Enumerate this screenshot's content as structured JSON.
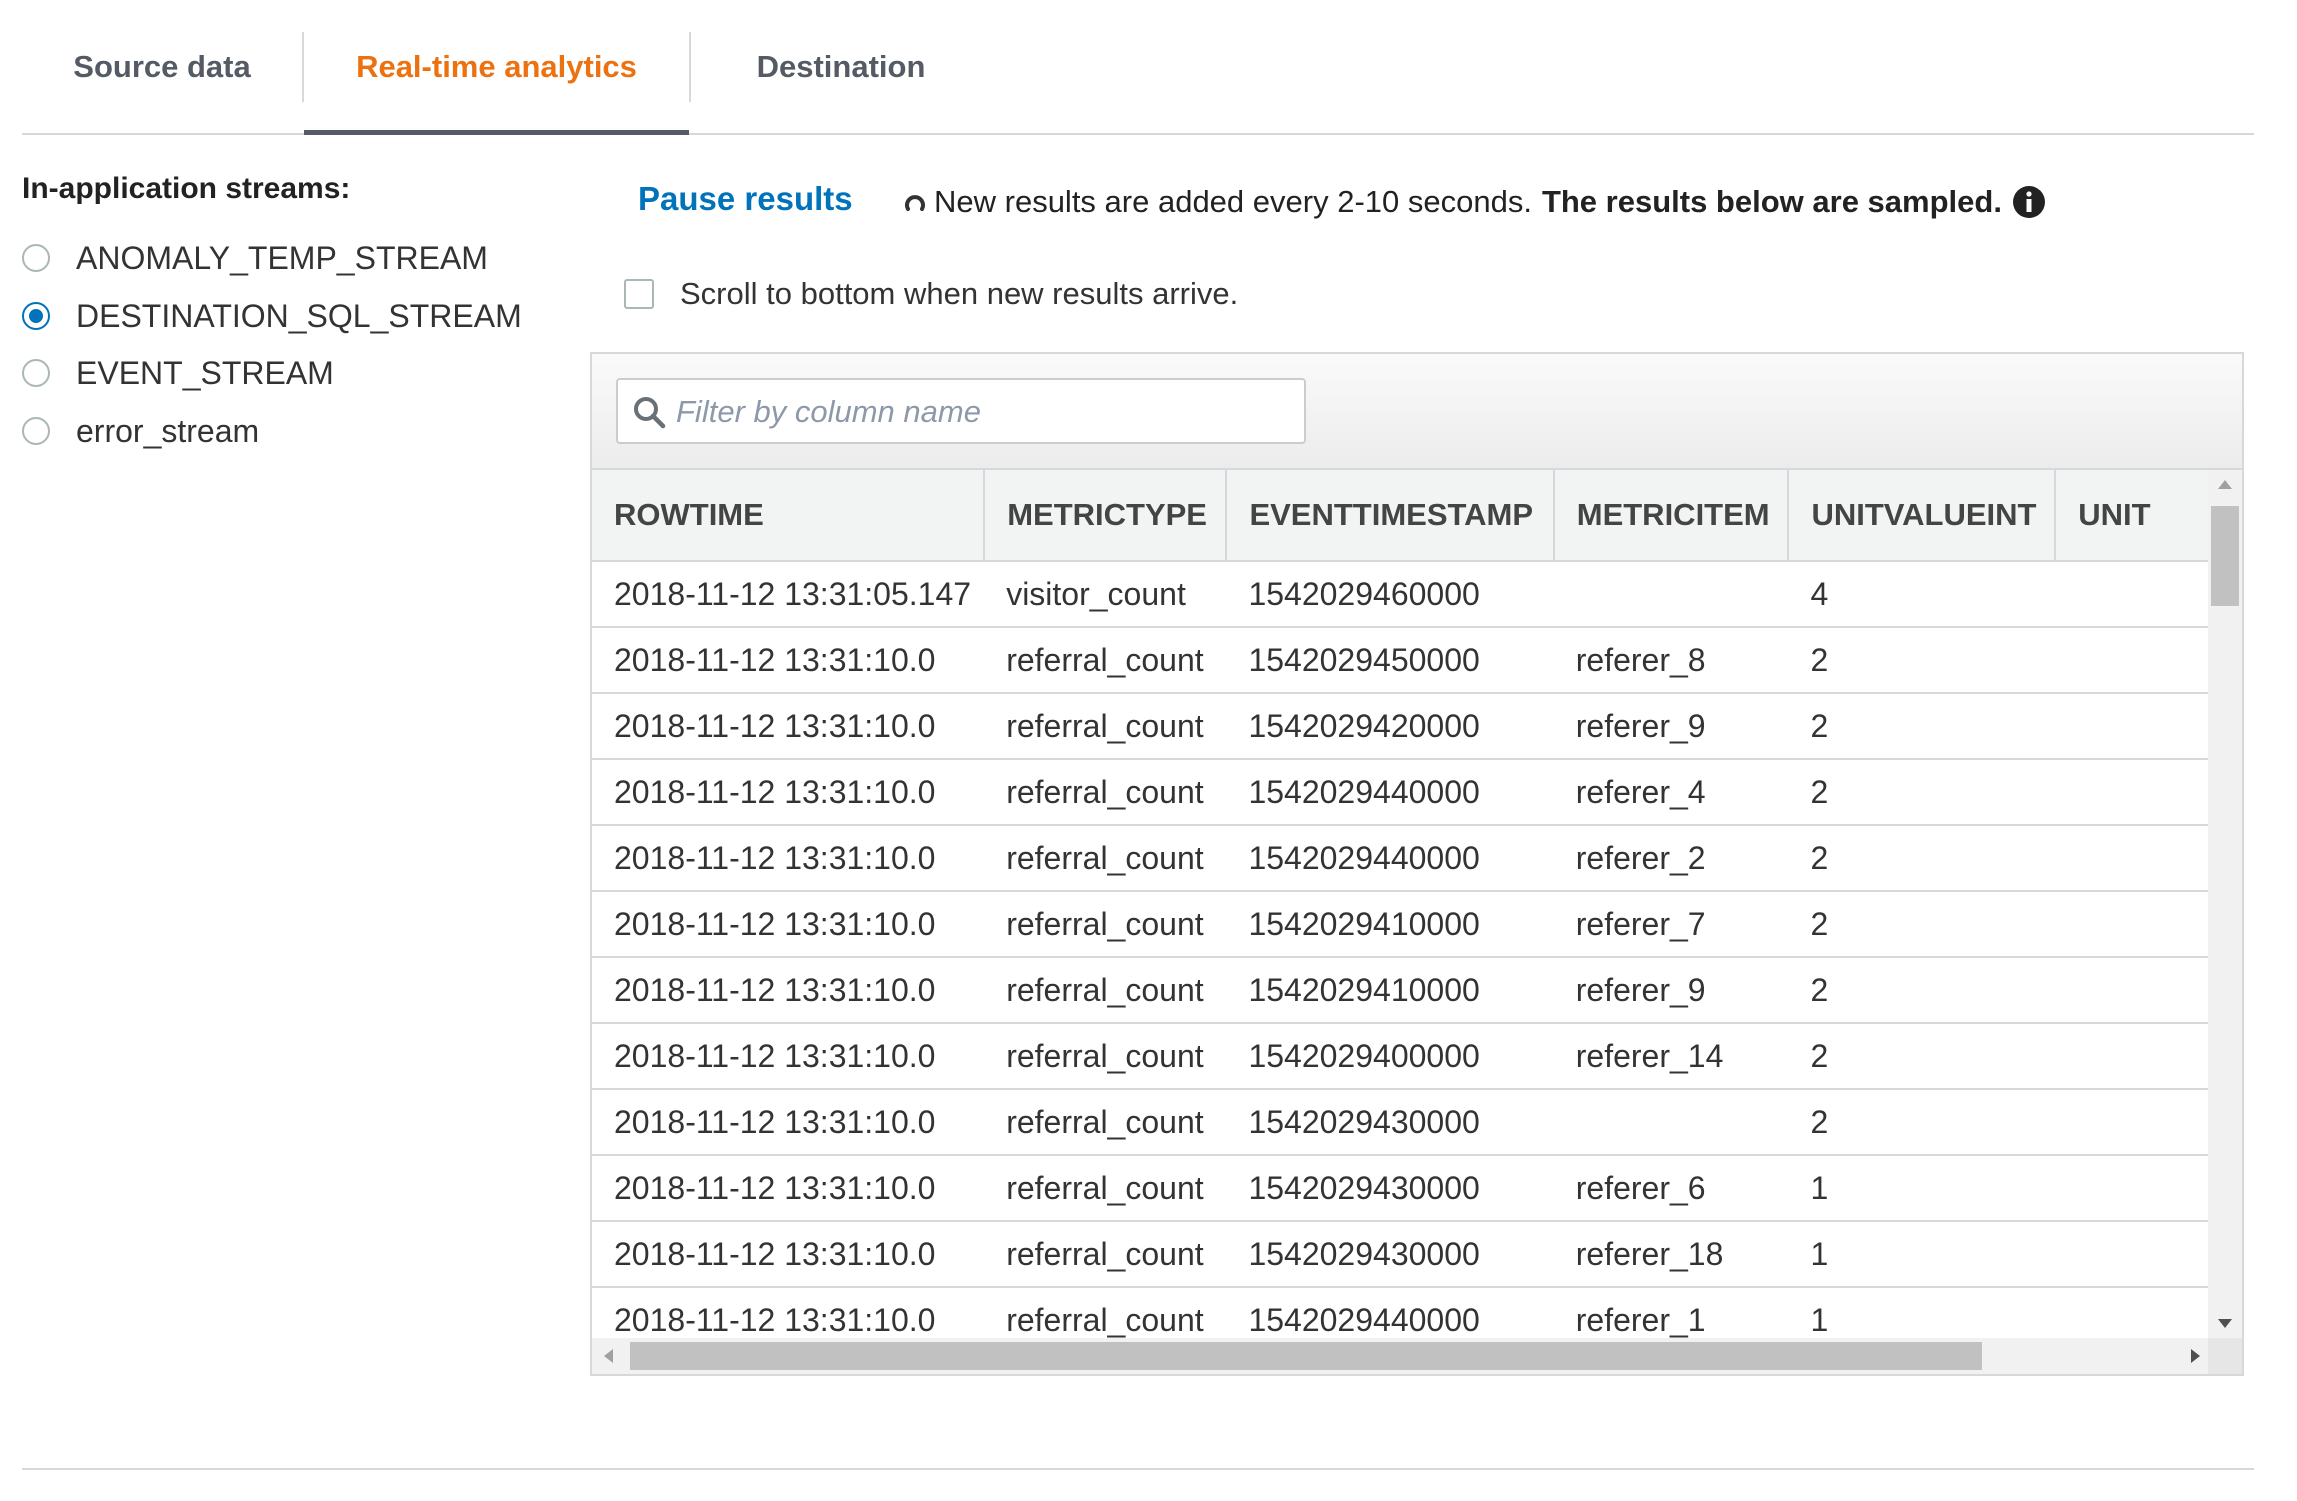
{
  "tabs": [
    {
      "label": "Source data",
      "active": false
    },
    {
      "label": "Real-time analytics",
      "active": true
    },
    {
      "label": "Destination",
      "active": false
    }
  ],
  "sidebar": {
    "title": "In-application streams:",
    "streams": [
      {
        "label": "ANOMALY_TEMP_STREAM",
        "selected": false
      },
      {
        "label": "DESTINATION_SQL_STREAM",
        "selected": true
      },
      {
        "label": "EVENT_STREAM",
        "selected": false
      },
      {
        "label": "error_stream",
        "selected": false
      }
    ]
  },
  "controls": {
    "pause_label": "Pause results",
    "status_text": "New results are added every 2-10 seconds.",
    "status_bold": "The results below are sampled.",
    "scroll_checkbox_label": "Scroll to bottom when new results arrive.",
    "scroll_checkbox_checked": false
  },
  "filter": {
    "placeholder": "Filter by column name",
    "value": ""
  },
  "table": {
    "columns": [
      "ROWTIME",
      "METRICTYPE",
      "EVENTTIMESTAMP",
      "METRICITEM",
      "UNITVALUEINT",
      "UNIT"
    ],
    "rows": [
      [
        "2018-11-12 13:31:05.147",
        "visitor_count",
        "1542029460000",
        "",
        "4",
        ""
      ],
      [
        "2018-11-12 13:31:10.0",
        "referral_count",
        "1542029450000",
        "referer_8",
        "2",
        ""
      ],
      [
        "2018-11-12 13:31:10.0",
        "referral_count",
        "1542029420000",
        "referer_9",
        "2",
        ""
      ],
      [
        "2018-11-12 13:31:10.0",
        "referral_count",
        "1542029440000",
        "referer_4",
        "2",
        ""
      ],
      [
        "2018-11-12 13:31:10.0",
        "referral_count",
        "1542029440000",
        "referer_2",
        "2",
        ""
      ],
      [
        "2018-11-12 13:31:10.0",
        "referral_count",
        "1542029410000",
        "referer_7",
        "2",
        ""
      ],
      [
        "2018-11-12 13:31:10.0",
        "referral_count",
        "1542029410000",
        "referer_9",
        "2",
        ""
      ],
      [
        "2018-11-12 13:31:10.0",
        "referral_count",
        "1542029400000",
        "referer_14",
        "2",
        ""
      ],
      [
        "2018-11-12 13:31:10.0",
        "referral_count",
        "1542029430000",
        "",
        "2",
        ""
      ],
      [
        "2018-11-12 13:31:10.0",
        "referral_count",
        "1542029430000",
        "referer_6",
        "1",
        ""
      ],
      [
        "2018-11-12 13:31:10.0",
        "referral_count",
        "1542029430000",
        "referer_18",
        "1",
        ""
      ],
      [
        "2018-11-12 13:31:10.0",
        "referral_count",
        "1542029440000",
        "referer_1",
        "1",
        ""
      ]
    ]
  },
  "colors": {
    "accent_tab": "#ec7211",
    "link": "#0073bb",
    "radio_selected": "#0073bb",
    "border": "#d5d9dd"
  },
  "icons": [
    "spinner-icon",
    "info-icon",
    "search-icon"
  ]
}
